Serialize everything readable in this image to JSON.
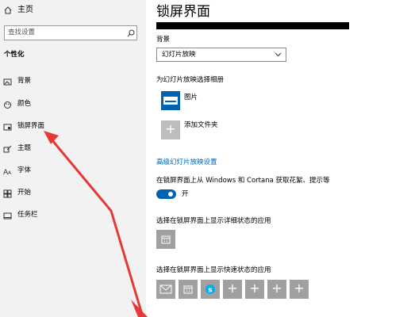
{
  "sidebar": {
    "home_label": "主页",
    "search_placeholder": "查找设置",
    "section_title": "个性化",
    "items": [
      {
        "label": "背景"
      },
      {
        "label": "颜色"
      },
      {
        "label": "锁屏界面"
      },
      {
        "label": "主题"
      },
      {
        "label": "字体"
      },
      {
        "label": "开始"
      },
      {
        "label": "任务栏"
      }
    ]
  },
  "main": {
    "page_title": "锁屏界面",
    "background_label": "背景",
    "background_value": "幻灯片放映",
    "album_label": "为幻灯片放映选择相册",
    "album_item": "图片",
    "add_folder": "添加文件夹",
    "advanced_link": "高级幻灯片放映设置",
    "fun_facts_label": "在锁屏界面上从 Windows 和 Cortana 获取花絮、提示等",
    "toggle_state": "开",
    "toggle_on": true,
    "detailed_status_label": "选择在锁屏界面上显示详细状态的应用",
    "quick_status_label": "选择在锁屏界面上显示快速状态的应用"
  },
  "colors": {
    "accent": "#0063b1",
    "arrow": "#e53935",
    "sidebar_bg": "#f2f2f2"
  }
}
